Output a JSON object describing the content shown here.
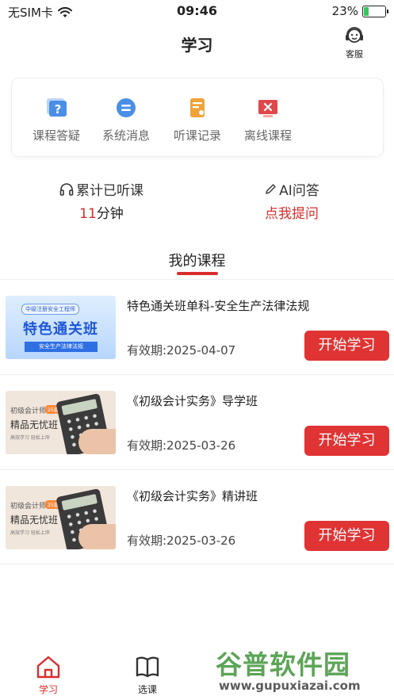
{
  "status_bar": {
    "carrier": "无SIM卡",
    "time": "09:46",
    "battery_percent": "23%",
    "battery_level": 0.23
  },
  "header": {
    "title": "学习",
    "service_label": "客服"
  },
  "quick_actions": [
    {
      "label": "课程答疑",
      "icon": "question-icon",
      "color": "#4a8ee6"
    },
    {
      "label": "系统消息",
      "icon": "message-icon",
      "color": "#4a8ee6"
    },
    {
      "label": "听课记录",
      "icon": "record-icon",
      "color": "#f0a338"
    },
    {
      "label": "离线课程",
      "icon": "offline-icon",
      "color": "#e0474c"
    }
  ],
  "stats": {
    "listened_label": "累计已听课",
    "listened_value": "11",
    "listened_unit": "分钟",
    "ai_label": "AI问答",
    "ai_action": "点我提问"
  },
  "section": {
    "title": "我的课程"
  },
  "courses": [
    {
      "title": "特色通关班单科-安全生产法律法规",
      "expiry": "有效期:2025-04-07",
      "button": "开始学习",
      "thumb": {
        "badge": "中级注册安全工程师",
        "big": "特色通关班",
        "bar": "安全生产法律法规"
      }
    },
    {
      "title": "《初级会计实务》导学班",
      "expiry": "有效期:2025-03-26",
      "button": "开始学习",
      "thumb": {
        "line1": "初级会计师",
        "tag": "25直播",
        "line2": "精品无忧班",
        "line3": "高效学习 轻松上岸"
      }
    },
    {
      "title": "《初级会计实务》精讲班",
      "expiry": "有效期:2025-03-26",
      "button": "开始学习",
      "thumb": {
        "line1": "初级会计师",
        "tag": "25直播",
        "line2": "精品无忧班",
        "line3": "高效学习 轻松上岸"
      }
    }
  ],
  "tabbar": {
    "items": [
      {
        "label": "学习",
        "active": true
      },
      {
        "label": "选课",
        "active": false
      }
    ]
  },
  "watermark": {
    "cn": "谷普软件园",
    "url": "www.gupuxiazai.com"
  },
  "colors": {
    "accent": "#d92d2d",
    "button": "#e03333"
  }
}
